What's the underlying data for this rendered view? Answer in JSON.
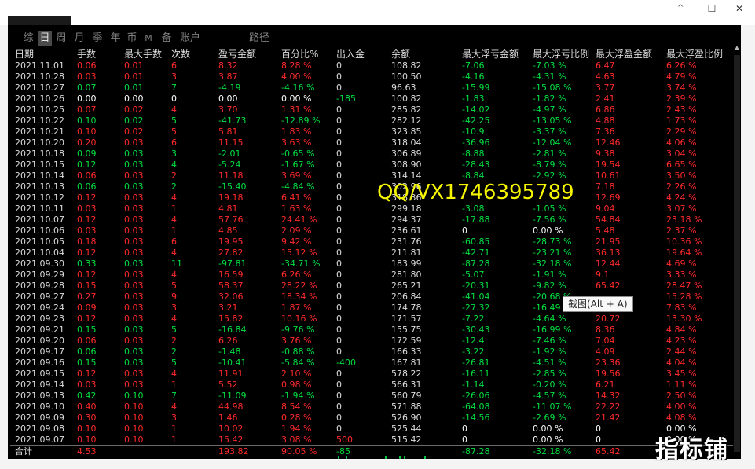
{
  "window": {
    "minimize": "—",
    "maximize": "☐",
    "close": "✕",
    "chevron": "^"
  },
  "tabs": [
    "综",
    "日",
    "周",
    "月",
    "季",
    "年",
    "币",
    "M",
    "备",
    "账户",
    "路径"
  ],
  "active_tab_index": 1,
  "columns": [
    "日期",
    "手数",
    "最大手数",
    "次数",
    "盈亏金额",
    "百分比%",
    "出入金",
    "余额",
    "最大浮亏金额",
    "最大浮亏比例",
    "最大浮盈金额",
    "最大浮盈比例"
  ],
  "rows": [
    [
      "2021.11.01",
      "0.06",
      "0.01",
      "6",
      "8.32",
      "8.28 %",
      "0",
      "108.82",
      "-7.06",
      "-7.03 %",
      "6.47",
      "6.26 %"
    ],
    [
      "2021.10.28",
      "0.03",
      "0.01",
      "3",
      "3.87",
      "4.00 %",
      "0",
      "100.50",
      "-4.16",
      "-4.31 %",
      "4.63",
      "4.79 %"
    ],
    [
      "2021.10.27",
      "0.07",
      "0.01",
      "7",
      "-4.19",
      "-4.16 %",
      "0",
      "96.63",
      "-15.99",
      "-15.08 %",
      "3.77",
      "3.74 %"
    ],
    [
      "2021.10.26",
      "0.00",
      "0.00",
      "0",
      "0.00",
      "0.00 %",
      "-185",
      "100.82",
      "-1.83",
      "-1.82 %",
      "2.41",
      "2.39 %"
    ],
    [
      "2021.10.25",
      "0.07",
      "0.02",
      "4",
      "3.70",
      "1.31 %",
      "0",
      "285.82",
      "-14.02",
      "-4.97 %",
      "6.86",
      "2.43 %"
    ],
    [
      "2021.10.22",
      "0.10",
      "0.02",
      "5",
      "-41.73",
      "-12.89 %",
      "0",
      "282.12",
      "-42.25",
      "-13.05 %",
      "4.88",
      "1.73 %"
    ],
    [
      "2021.10.21",
      "0.10",
      "0.02",
      "5",
      "5.81",
      "1.83 %",
      "0",
      "323.85",
      "-10.9",
      "-3.37 %",
      "7.36",
      "2.29 %"
    ],
    [
      "2021.10.20",
      "0.20",
      "0.03",
      "6",
      "11.15",
      "3.63 %",
      "0",
      "318.04",
      "-36.96",
      "-12.04 %",
      "12.46",
      "4.06 %"
    ],
    [
      "2021.10.18",
      "0.09",
      "0.03",
      "3",
      "-2.01",
      "-0.65 %",
      "0",
      "306.89",
      "-8.88",
      "-2.81 %",
      "9.38",
      "3.04 %"
    ],
    [
      "2021.10.15",
      "0.12",
      "0.03",
      "4",
      "-5.24",
      "-1.67 %",
      "0",
      "308.90",
      "-28.43",
      "-8.79 %",
      "19.54",
      "6.65 %"
    ],
    [
      "2021.10.14",
      "0.06",
      "0.03",
      "2",
      "11.18",
      "3.69 %",
      "0",
      "314.14",
      "-8.84",
      "-2.92 %",
      "10.61",
      "3.50 %"
    ],
    [
      "2021.10.13",
      "0.06",
      "0.03",
      "2",
      "-15.40",
      "-4.84 %",
      "0",
      "302.96",
      "",
      "",
      "7.18",
      "2.26 %"
    ],
    [
      "2021.10.12",
      "0.12",
      "0.03",
      "4",
      "19.18",
      "6.41 %",
      "0",
      "318.36",
      "",
      "",
      "12.69",
      "4.24 %"
    ],
    [
      "2021.10.11",
      "0.03",
      "0.03",
      "1",
      "4.81",
      "1.63 %",
      "0",
      "299.18",
      "-3.08",
      "-1.05 %",
      "9.04",
      "3.07 %"
    ],
    [
      "2021.10.07",
      "0.12",
      "0.03",
      "4",
      "57.76",
      "24.41 %",
      "0",
      "294.37",
      "-17.88",
      "-7.56 %",
      "54.84",
      "23.18 %"
    ],
    [
      "2021.10.06",
      "0.03",
      "0.03",
      "1",
      "4.85",
      "2.09 %",
      "0",
      "236.61",
      "0",
      "0.00 %",
      "5.48",
      "2.37 %"
    ],
    [
      "2021.10.05",
      "0.18",
      "0.03",
      "6",
      "19.95",
      "9.42 %",
      "0",
      "231.76",
      "-60.85",
      "-28.73 %",
      "21.95",
      "10.36 %"
    ],
    [
      "2021.10.04",
      "0.12",
      "0.03",
      "4",
      "27.82",
      "15.12 %",
      "0",
      "211.81",
      "-42.71",
      "-23.21 %",
      "36.13",
      "19.64 %"
    ],
    [
      "2021.09.30",
      "0.33",
      "0.03",
      "11",
      "-97.81",
      "-34.71 %",
      "0",
      "183.99",
      "-87.28",
      "-32.18 %",
      "12.44",
      "4.69 %"
    ],
    [
      "2021.09.29",
      "0.12",
      "0.03",
      "4",
      "16.59",
      "6.26 %",
      "0",
      "281.80",
      "-5.07",
      "-1.91 %",
      "9.1",
      "3.33 %"
    ],
    [
      "2021.09.28",
      "0.15",
      "0.03",
      "5",
      "58.37",
      "28.22 %",
      "0",
      "265.21",
      "-20.31",
      "-9.82 %",
      "65.42",
      "28.47 %"
    ],
    [
      "2021.09.27",
      "0.27",
      "0.03",
      "9",
      "32.06",
      "18.34 %",
      "0",
      "206.84",
      "-41.04",
      "-20.68 %",
      "",
      "15.28 %"
    ],
    [
      "2021.09.24",
      "0.09",
      "0.03",
      "3",
      "3.21",
      "1.87 %",
      "0",
      "174.78",
      "-27.32",
      "-16.49 %",
      "",
      "7.83 %"
    ],
    [
      "2021.09.23",
      "0.12",
      "0.03",
      "4",
      "15.82",
      "10.16 %",
      "0",
      "171.57",
      "-7.22",
      "-4.64 %",
      "20.72",
      "13.30 %"
    ],
    [
      "2021.09.21",
      "0.15",
      "0.03",
      "5",
      "-16.84",
      "-9.76 %",
      "0",
      "155.75",
      "-30.43",
      "-16.99 %",
      "8.36",
      "4.84 %"
    ],
    [
      "2021.09.20",
      "0.06",
      "0.03",
      "2",
      "6.26",
      "3.76 %",
      "0",
      "172.59",
      "-12.4",
      "-7.46 %",
      "7.04",
      "4.23 %"
    ],
    [
      "2021.09.17",
      "0.06",
      "0.03",
      "2",
      "-1.48",
      "-0.88 %",
      "0",
      "166.33",
      "-3.22",
      "-1.92 %",
      "4.09",
      "2.44 %"
    ],
    [
      "2021.09.16",
      "0.15",
      "0.03",
      "5",
      "-10.41",
      "-5.84 %",
      "-400",
      "167.81",
      "-26.81",
      "-4.51 %",
      "23.36",
      "4.04 %"
    ],
    [
      "2021.09.15",
      "0.12",
      "0.03",
      "4",
      "11.91",
      "2.10 %",
      "0",
      "578.22",
      "-16.11",
      "-2.85 %",
      "19.56",
      "3.45 %"
    ],
    [
      "2021.09.14",
      "0.03",
      "0.03",
      "1",
      "5.52",
      "0.98 %",
      "0",
      "566.31",
      "-1.14",
      "-0.20 %",
      "6.21",
      "1.11 %"
    ],
    [
      "2021.09.13",
      "0.42",
      "0.10",
      "7",
      "-11.09",
      "-1.94 %",
      "0",
      "560.79",
      "-26.06",
      "-4.57 %",
      "14.32",
      "2.50 %"
    ],
    [
      "2021.09.10",
      "0.40",
      "0.10",
      "4",
      "44.98",
      "8.54 %",
      "0",
      "571.88",
      "-64.08",
      "-11.07 %",
      "22.22",
      "4.00 %"
    ],
    [
      "2021.09.09",
      "0.30",
      "0.10",
      "3",
      "1.46",
      "0.28 %",
      "0",
      "526.90",
      "-14.56",
      "-2.69 %",
      "21.42",
      "4.08 %"
    ],
    [
      "2021.09.08",
      "0.10",
      "0.10",
      "1",
      "10.02",
      "1.94 %",
      "0",
      "525.44",
      "0",
      "0.00 %",
      "0",
      "0.00 %"
    ],
    [
      "2021.09.07",
      "0.10",
      "0.10",
      "1",
      "15.42",
      "3.08 %",
      "500",
      "515.42",
      "0",
      "0.00 %",
      "0",
      "0.00 %"
    ]
  ],
  "total": [
    "合计",
    "4.53",
    "",
    "",
    "193.82",
    "90.05 %",
    "-85",
    "",
    "-87.28",
    "-32.18 %",
    "65.42",
    ""
  ],
  "watermark": "QQ/VX1746395789",
  "tooltip": "截图(Alt + A)",
  "brand": "指标铺",
  "colors": {
    "positive": "#ff2a2a",
    "negative": "#00e040",
    "neutral": "#dcdcdc",
    "zero_pct": "#ffffff",
    "background": "#000000"
  }
}
